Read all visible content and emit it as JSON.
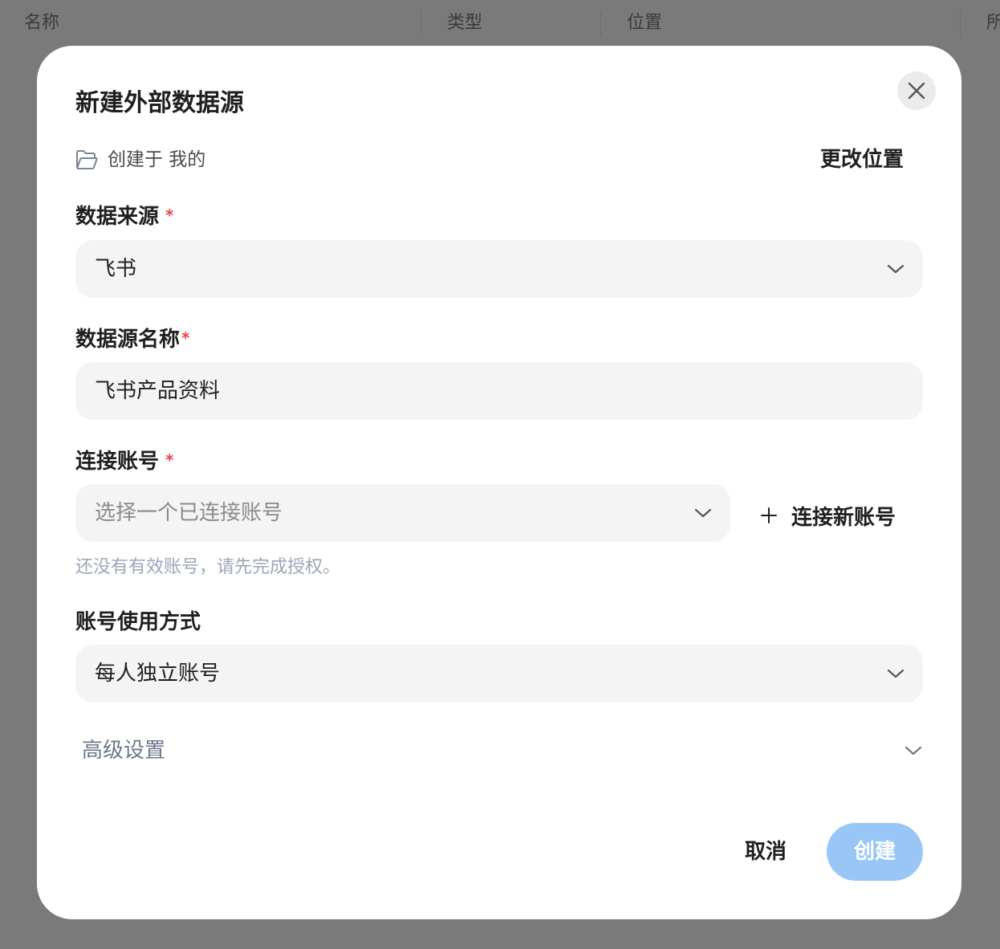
{
  "background_table": {
    "columns": [
      "名称",
      "类型",
      "位置",
      "所"
    ]
  },
  "dialog": {
    "title": "新建外部数据源",
    "close_icon": "close-icon",
    "location": {
      "folder_icon": "folder-open-icon",
      "text": "创建于 我的",
      "change_label": "更改位置"
    },
    "fields": {
      "source": {
        "label": "数据来源",
        "required_mark": "*",
        "value": "飞书"
      },
      "name": {
        "label": "数据源名称",
        "required_mark": "*",
        "value": "飞书产品资料"
      },
      "account": {
        "label": "连接账号",
        "required_mark": "*",
        "placeholder": "选择一个已连接账号",
        "connect_new_label": "连接新账号",
        "hint": "还没有有效账号，请先完成授权。"
      },
      "usage": {
        "label": "账号使用方式",
        "value": "每人独立账号"
      }
    },
    "advanced_label": "高级设置",
    "cancel_label": "取消",
    "create_label": "创建"
  },
  "colors": {
    "required": "#e5484d",
    "create_button_disabled": "#98c7f7",
    "hint": "#9aa6b8",
    "input_bg": "#f4f4f5"
  }
}
